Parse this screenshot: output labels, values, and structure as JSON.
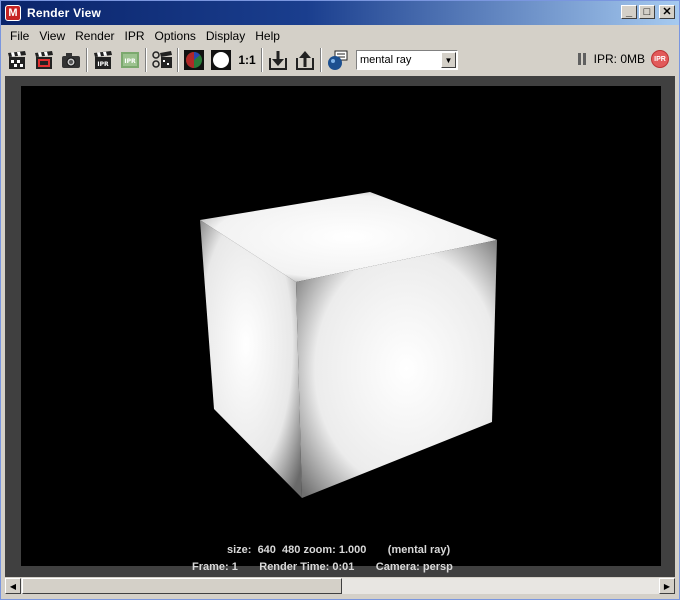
{
  "window": {
    "title": "Render View"
  },
  "title_buttons": {
    "minimize": "_",
    "maximize": "□",
    "close": "✕"
  },
  "menu": [
    "File",
    "View",
    "Render",
    "IPR",
    "Options",
    "Display",
    "Help"
  ],
  "toolbar": {
    "ratio_label": "1:1",
    "renderer": "mental ray",
    "ipr_memory": "IPR: 0MB",
    "ipr_badge": "IPR",
    "icons": [
      "clapper-redo-icon",
      "clapper-region-icon",
      "snapshot-camera-icon",
      "ipr-clapper-icon",
      "ipr-region-icon",
      "render-settings-icon",
      "rgb-channel-icon",
      "alpha-channel-icon",
      "keep-image-icon",
      "remove-image-icon",
      "render-globals-icon"
    ]
  },
  "viewport": {
    "info_line1": "size:  640  480 zoom: 1.000       (mental ray)",
    "info_line2": "Frame: 1       Render Time: 0:01       Camera: persp"
  },
  "colors": {
    "title_start": "#0a246a",
    "title_end": "#a6caf0",
    "background": "#d4d0c8",
    "viewport_frame": "#404040"
  }
}
